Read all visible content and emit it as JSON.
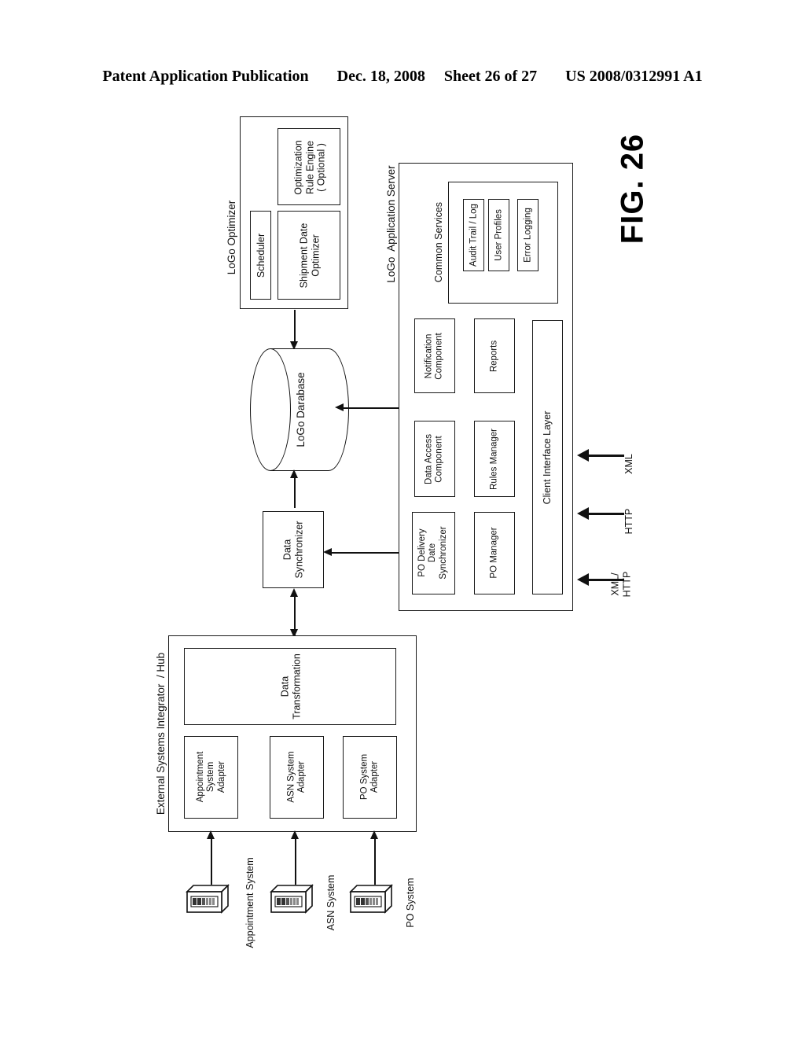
{
  "header": {
    "publication": "Patent Application Publication",
    "date": "Dec. 18, 2008",
    "sheet": "Sheet 26 of 27",
    "patent_number": "US 2008/0312991 A1"
  },
  "figure": {
    "label": "FIG. 26"
  },
  "diagram": {
    "optimizer": {
      "title": "LoGo Optimizer",
      "components": [
        {
          "label": "Scheduler"
        },
        {
          "label": "Shipment Date\nOptimizer"
        },
        {
          "label": "Optimization\nRule Engine\n( Optional )"
        }
      ]
    },
    "app_server": {
      "title": "LoGo  Application Server",
      "common_services": {
        "title": "Common Services",
        "items": [
          {
            "label": "Audit Trail / Log"
          },
          {
            "label": "User Profiles"
          },
          {
            "label": "Error Logging"
          }
        ]
      },
      "components": [
        {
          "label": "Notification\nComponent"
        },
        {
          "label": "Reports"
        },
        {
          "label": "Data Access\nComponent"
        },
        {
          "label": "Rules Manager"
        },
        {
          "label": "PO Delivery\nDate\nSynchronizer"
        },
        {
          "label": "PO Manager"
        }
      ],
      "client_interface_layer": {
        "label": "Client Interface Layer"
      },
      "protocols": [
        {
          "label": "XML"
        },
        {
          "label": "HTTP"
        },
        {
          "label": "XML/\nHTTP"
        }
      ]
    },
    "database": {
      "label": "LoGo Darabase"
    },
    "data_synchronizer": {
      "label": "Data\nSynchronizer"
    },
    "integrator": {
      "title": "External Systems Integrator  / Hub",
      "transformation": {
        "label": "Data\nTransformation"
      },
      "adapters": [
        {
          "label": "Appointment\nSystem\nAdapter"
        },
        {
          "label": "ASN System\nAdapter"
        },
        {
          "label": "PO System\nAdapter"
        }
      ]
    },
    "external_systems": [
      {
        "label": "Appointment System"
      },
      {
        "label": "ASN System"
      },
      {
        "label": "PO System"
      }
    ]
  }
}
